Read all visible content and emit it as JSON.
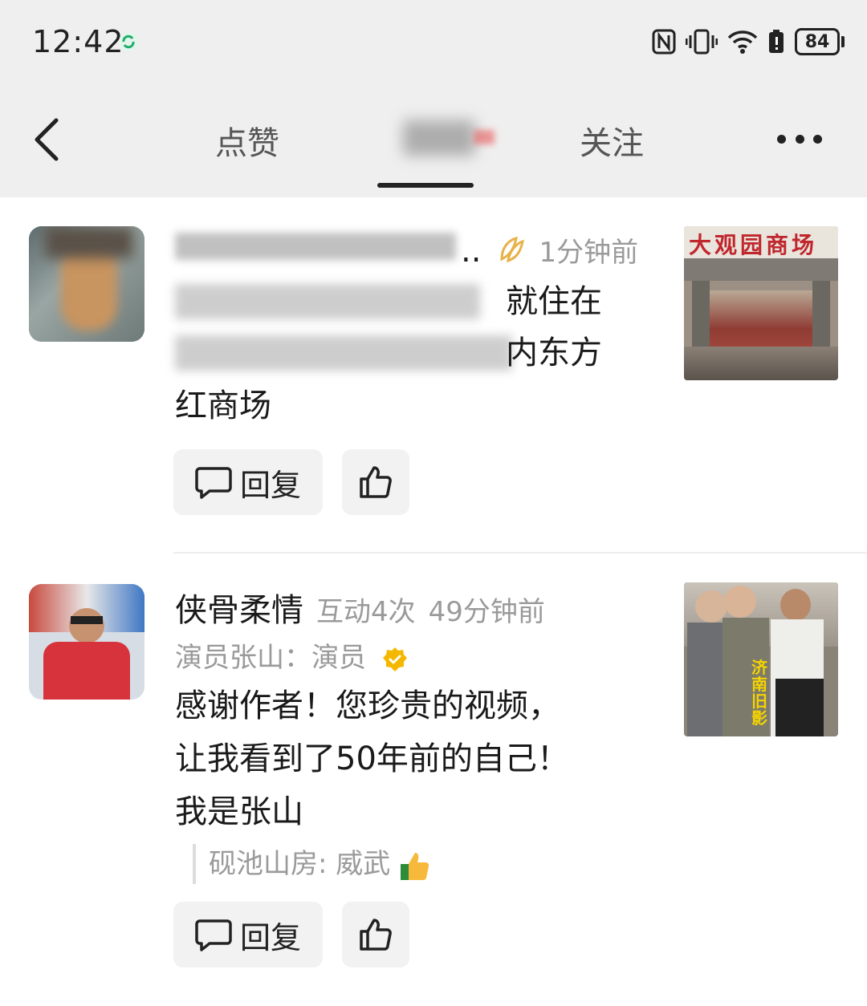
{
  "status_bar": {
    "time": "12:42",
    "battery": "84",
    "icons": [
      "nfc-icon",
      "vibrate-icon",
      "wifi-icon",
      "battery-saver-icon",
      "battery-icon"
    ]
  },
  "nav": {
    "back_icon": "chevron-left-icon",
    "tabs": [
      {
        "label": "点赞",
        "active": false
      },
      {
        "label": "",
        "active": true
      },
      {
        "label": "关注",
        "active": false
      }
    ],
    "more_icon": "more-icon"
  },
  "comments": [
    {
      "username": "",
      "username_tail": "..",
      "badge_icon": "double-leaf-icon",
      "time": "1分钟前",
      "lines": [
        "就住在",
        "内东方",
        "红商场"
      ],
      "reply_label": "回复",
      "thumb_caption": "大观园商场"
    },
    {
      "username": "侠骨柔情",
      "interactions": "互动4次",
      "time": "49分钟前",
      "role_line": "演员张山：演员",
      "lines": [
        "感谢作者！您珍贵的视频，",
        "让我看到了50年前的自己！",
        "我是张山"
      ],
      "quote": "砚池山房: 威武",
      "reply_label": "回复",
      "thumb_caption": "济南旧影"
    }
  ],
  "colors": {
    "header_bg": "#efefef",
    "meta_gray": "#9a9a9a",
    "verified_gold": "#f5b800",
    "button_bg": "#f2f2f2"
  }
}
